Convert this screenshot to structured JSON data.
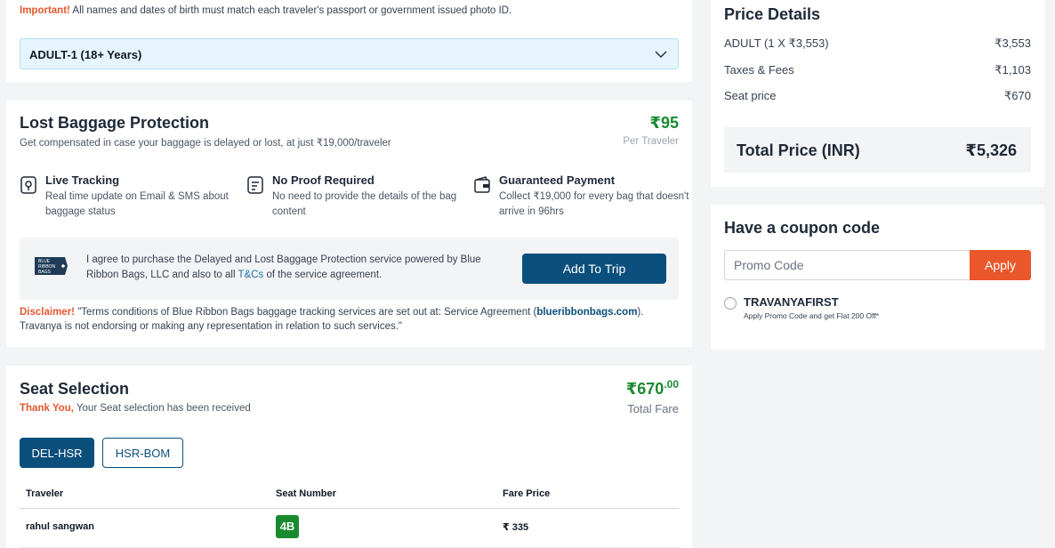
{
  "traveler": {
    "important_label": "Important!",
    "important_text": "All names and dates of birth must match each traveler's passport or government issued photo ID.",
    "adult_label": "ADULT-1 (18+ Years)"
  },
  "baggage": {
    "title": "Lost Baggage Protection",
    "subtitle": "Get compensated in case your baggage is delayed or lost, at just ₹19,000/traveler",
    "price": "₹95",
    "price_unit": "Per Traveler",
    "features": [
      {
        "title": "Live Tracking",
        "desc": "Real time update on Email & SMS about baggage status",
        "icon": "location-pin-icon"
      },
      {
        "title": "No Proof Required",
        "desc": "No need to provide the details of the bag content",
        "icon": "document-icon"
      },
      {
        "title": "Guaranteed Payment",
        "desc": "Collect ₹19,000 for every bag that doesn't arrive in 96hrs",
        "icon": "wallet-icon"
      }
    ],
    "agree_text_1": "I agree to purchase the Delayed and Lost Baggage Protection service powered by Blue Ribbon Bags, LLC and also to all",
    "agree_link": "T&Cs",
    "agree_text_2": "of the service agreement.",
    "logo_text": [
      "BLUE",
      "RIBBON",
      "BAGS"
    ],
    "add_button": "Add To Trip",
    "disclaimer_label": "Disclaimer!",
    "disclaimer_text_1": "\"Terms conditions of Blue Ribbon Bags baggage tracking services are set out at: Service Agreement (",
    "disclaimer_link": "blueribbonbags.com",
    "disclaimer_text_2": "). Travanya is not endorsing or making any representation in relation to such services.\""
  },
  "seat": {
    "title": "Seat Selection",
    "thanks_label": "Thank You,",
    "thanks_text": "Your Seat selection has been received",
    "price_main": "₹670",
    "price_decimal": ".00",
    "total_fare": "Total Fare",
    "tabs": [
      {
        "label": "DEL-HSR",
        "active": true
      },
      {
        "label": "HSR-BOM",
        "active": false
      }
    ],
    "columns": [
      "Traveler",
      "Seat Number",
      "Fare Price"
    ],
    "rows": [
      {
        "traveler": "rahul sangwan",
        "seat": "4B",
        "fare": "₹ 335"
      }
    ]
  },
  "price_details": {
    "title": "Price Details",
    "rows": [
      {
        "label": "ADULT (1 X ₹3,553)",
        "value": "₹3,553"
      },
      {
        "label": "Taxes & Fees",
        "value": "₹1,103"
      },
      {
        "label": "Seat price",
        "value": "₹670"
      }
    ],
    "total_label": "Total Price (INR)",
    "total_value": "₹5,326"
  },
  "coupon": {
    "title": "Have a coupon code",
    "placeholder": "Promo Code",
    "apply": "Apply",
    "code": "TRAVANYAFIRST",
    "code_desc": "Apply Promo Code and get Flat 200 Off*"
  },
  "colors": {
    "primary": "#0b4f7c",
    "accent_orange": "#e9572b",
    "price_green": "#1a8a2e"
  }
}
